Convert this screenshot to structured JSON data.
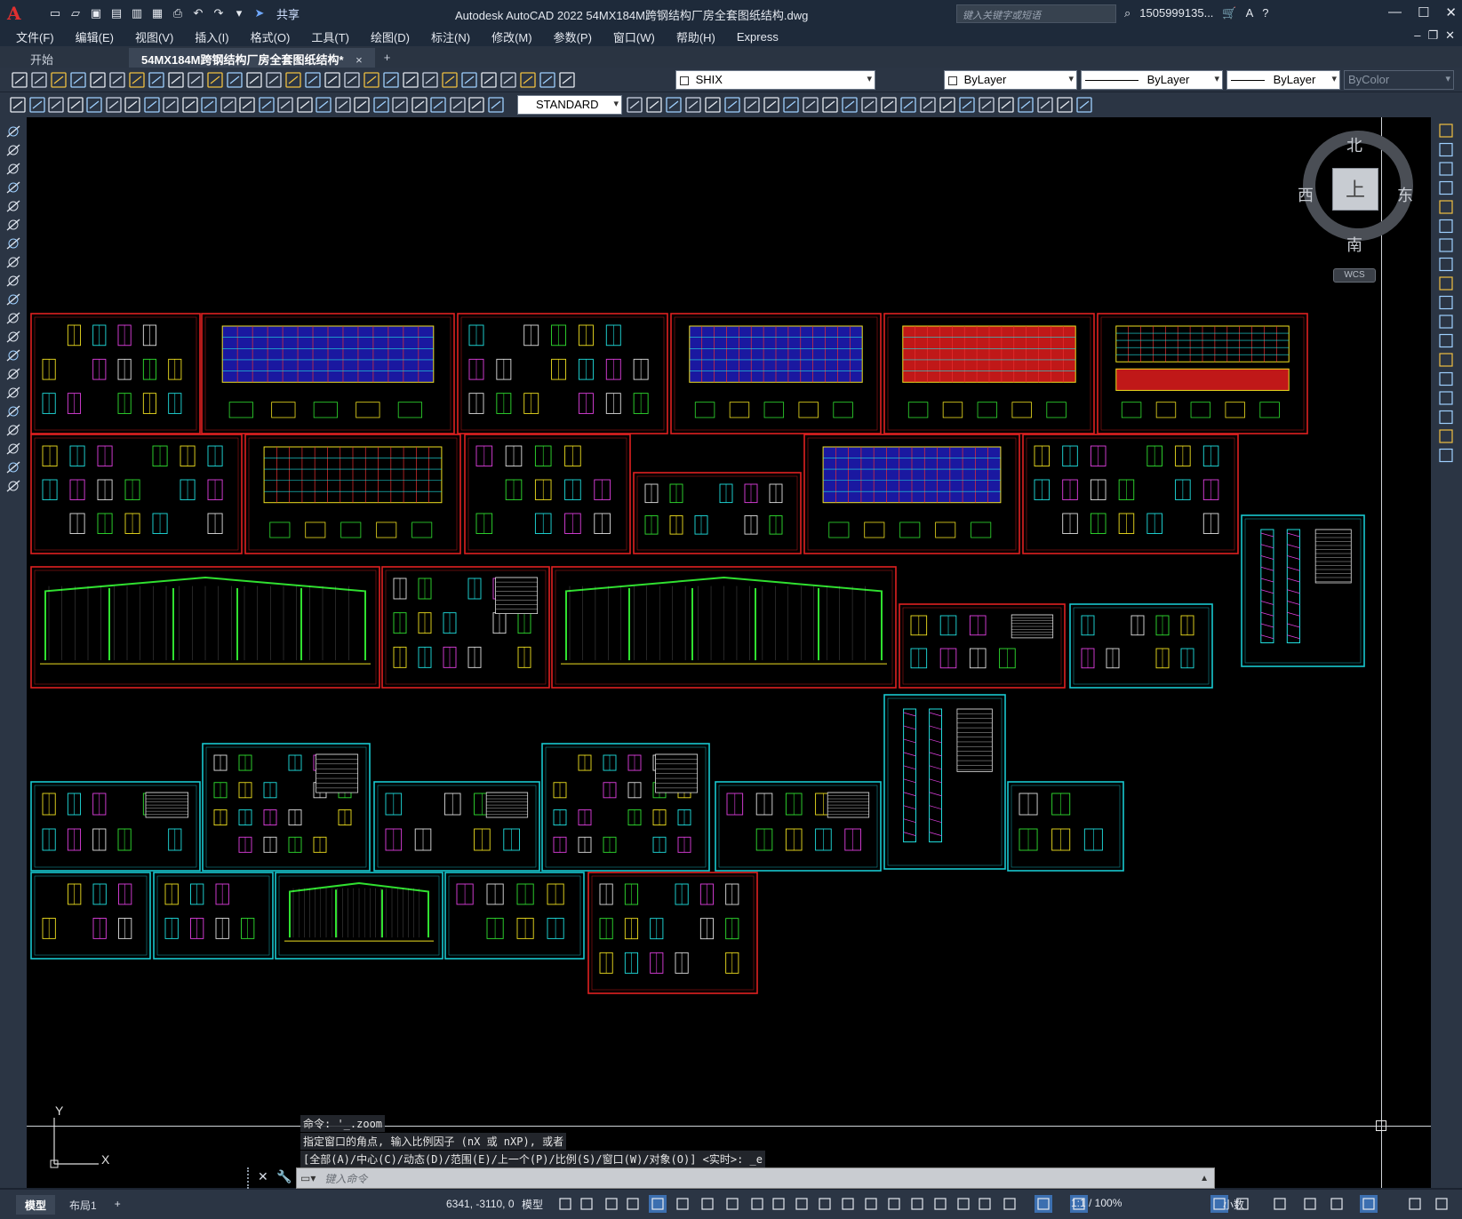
{
  "app": {
    "logo": "A",
    "title": "Autodesk AutoCAD 2022    54MX184M跨钢结构厂房全套图纸结构.dwg",
    "share_label": "共享",
    "search_placeholder": "键入关键字或短语",
    "user": "1505999135...",
    "window_controls": [
      "minimize-icon",
      "maximize-icon",
      "close-icon"
    ]
  },
  "menu": {
    "items": [
      "文件(F)",
      "编辑(E)",
      "视图(V)",
      "插入(I)",
      "格式(O)",
      "工具(T)",
      "绘图(D)",
      "标注(N)",
      "修改(M)",
      "参数(P)",
      "窗口(W)",
      "帮助(H)",
      "Express"
    ]
  },
  "tabs": {
    "items": [
      {
        "label": "开始",
        "active": false
      },
      {
        "label": "54MX184M跨钢结构厂房全套图纸结构*",
        "active": true
      }
    ],
    "close_glyph": "×",
    "add_glyph": "+"
  },
  "toolbar": {
    "layer_value": "SHIX",
    "color_value": "ByLayer",
    "linetype_value": "ByLayer",
    "lineweight_value": "ByLayer",
    "plotstyle_value": "ByColor",
    "dimstyle_value": "STANDARD"
  },
  "viewcube": {
    "north": "北",
    "south": "南",
    "east": "东",
    "west": "西",
    "face": "上",
    "wcs_label": "WCS"
  },
  "ucs": {
    "x_label": "X",
    "y_label": "Y"
  },
  "command": {
    "history": [
      "命令: '_.zoom",
      "指定窗口的角点, 输入比例因子 (nX 或 nXP), 或者",
      "[全部(A)/中心(C)/动态(D)/范围(E)/上一个(P)/比例(S)/窗口(W)/对象(O)] <实时>: _e"
    ],
    "input_placeholder": "键入命令"
  },
  "statusbar": {
    "layout_tabs": [
      {
        "label": "模型",
        "active": true
      },
      {
        "label": "布局1",
        "active": false
      }
    ],
    "add_glyph": "+",
    "coordinates": "6341, -3110, 0",
    "model_label": "模型",
    "scale": "1:1 / 100%",
    "units": "小数"
  },
  "colors": {
    "canvas": "#000000",
    "sheet_red": "#e02020",
    "sheet_cyan": "#18c8d0",
    "ui_dark": "#1e2a3a",
    "ui_toolbar": "#2b3544"
  }
}
